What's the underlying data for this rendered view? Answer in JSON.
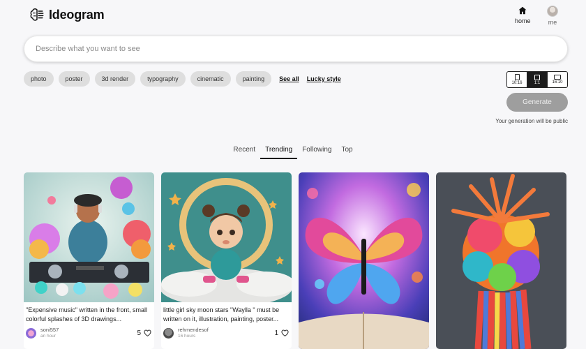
{
  "app": {
    "brand": "Ideogram"
  },
  "nav": {
    "home_label": "home",
    "me_label": "me",
    "home_icon": "home-icon"
  },
  "prompt": {
    "placeholder": "Describe what you want to see",
    "value": ""
  },
  "style_chips": [
    "photo",
    "poster",
    "3d render",
    "typography",
    "cinematic",
    "painting"
  ],
  "style_links": {
    "see_all": "See all",
    "lucky_style": "Lucky style"
  },
  "aspect_ratios": {
    "options": [
      "10:16",
      "1:1",
      "16:10"
    ],
    "selected": "1:1"
  },
  "generate": {
    "label": "Generate",
    "note": "Your generation will be public"
  },
  "feed_tabs": {
    "items": [
      "Recent",
      "Trending",
      "Following",
      "Top"
    ],
    "active": "Trending"
  },
  "cards": [
    {
      "caption": "\"Expensive music\" written in the front, small colorful splashes of 3D drawings...",
      "user": "soni557",
      "time": "an hour",
      "likes": "5"
    },
    {
      "caption": "little girl sky moon stars \"Waylla \" must be written on it, illustration, painting, poster...",
      "user": "rehmendesof",
      "time": "16 hours",
      "likes": "1"
    },
    {
      "caption": "",
      "user": "",
      "time": "",
      "likes": ""
    },
    {
      "caption": "",
      "user": "",
      "time": "",
      "likes": ""
    }
  ],
  "colors": {
    "background": "#f7f7f9",
    "chip": "#dedede",
    "generate_disabled": "#9e9e9e",
    "active_tab": "#111111"
  }
}
